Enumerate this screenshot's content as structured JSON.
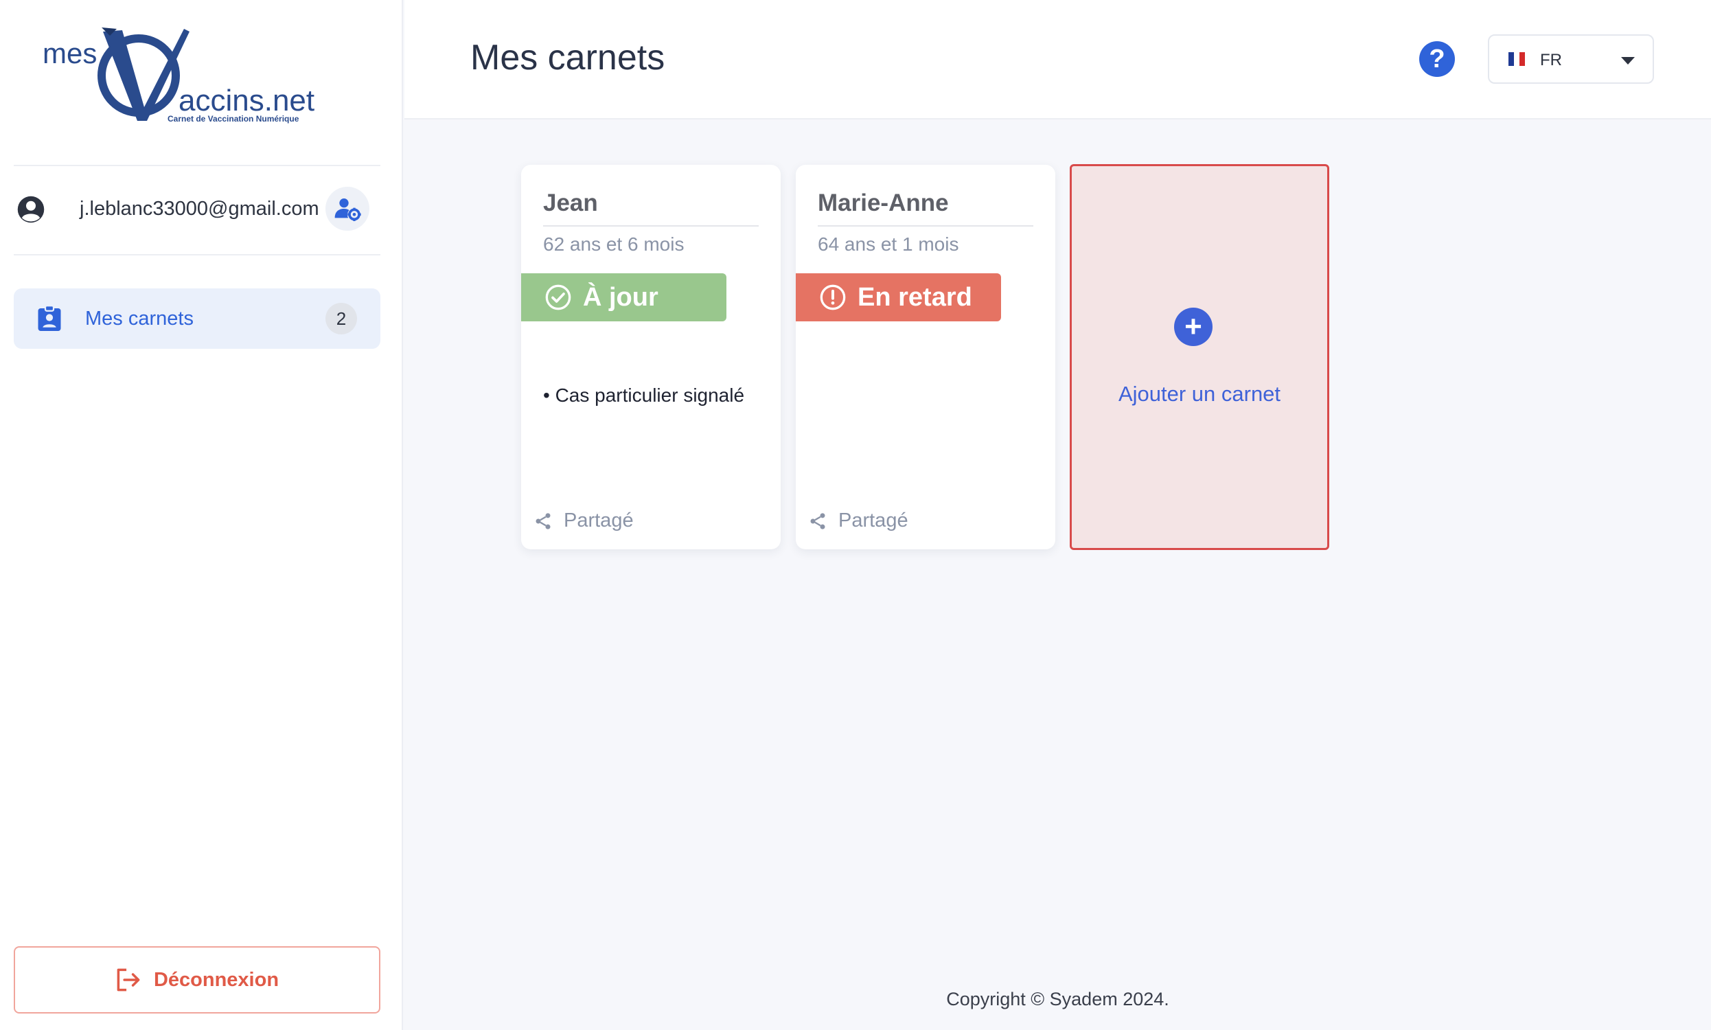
{
  "logo": {
    "prefix": "mes",
    "suffix": "accins.net",
    "tagline": "Carnet de Vaccination Numérique"
  },
  "user": {
    "email": "j.leblanc33000@gmail.com"
  },
  "nav": {
    "items": [
      {
        "label": "Mes carnets",
        "count": "2"
      }
    ]
  },
  "logout": {
    "label": "Déconnexion"
  },
  "header": {
    "title": "Mes carnets",
    "help": "?",
    "language": "FR"
  },
  "cards": [
    {
      "name": "Jean",
      "age": "62 ans et 6 mois",
      "status": "À jour",
      "note": "• Cas particulier signalé",
      "shared": "Partagé"
    },
    {
      "name": "Marie-Anne",
      "age": "64 ans et 1 mois",
      "status": "En retard",
      "note": "",
      "shared": "Partagé"
    }
  ],
  "add_card": {
    "label": "Ajouter un carnet",
    "icon": "+"
  },
  "footer": {
    "copyright": "Copyright © Syadem 2024."
  },
  "colors": {
    "accent": "#2f63d9",
    "ok": "#99c78d",
    "late": "#e57363",
    "add_bg": "#f4e4e5",
    "add_border": "#d84a4a"
  }
}
